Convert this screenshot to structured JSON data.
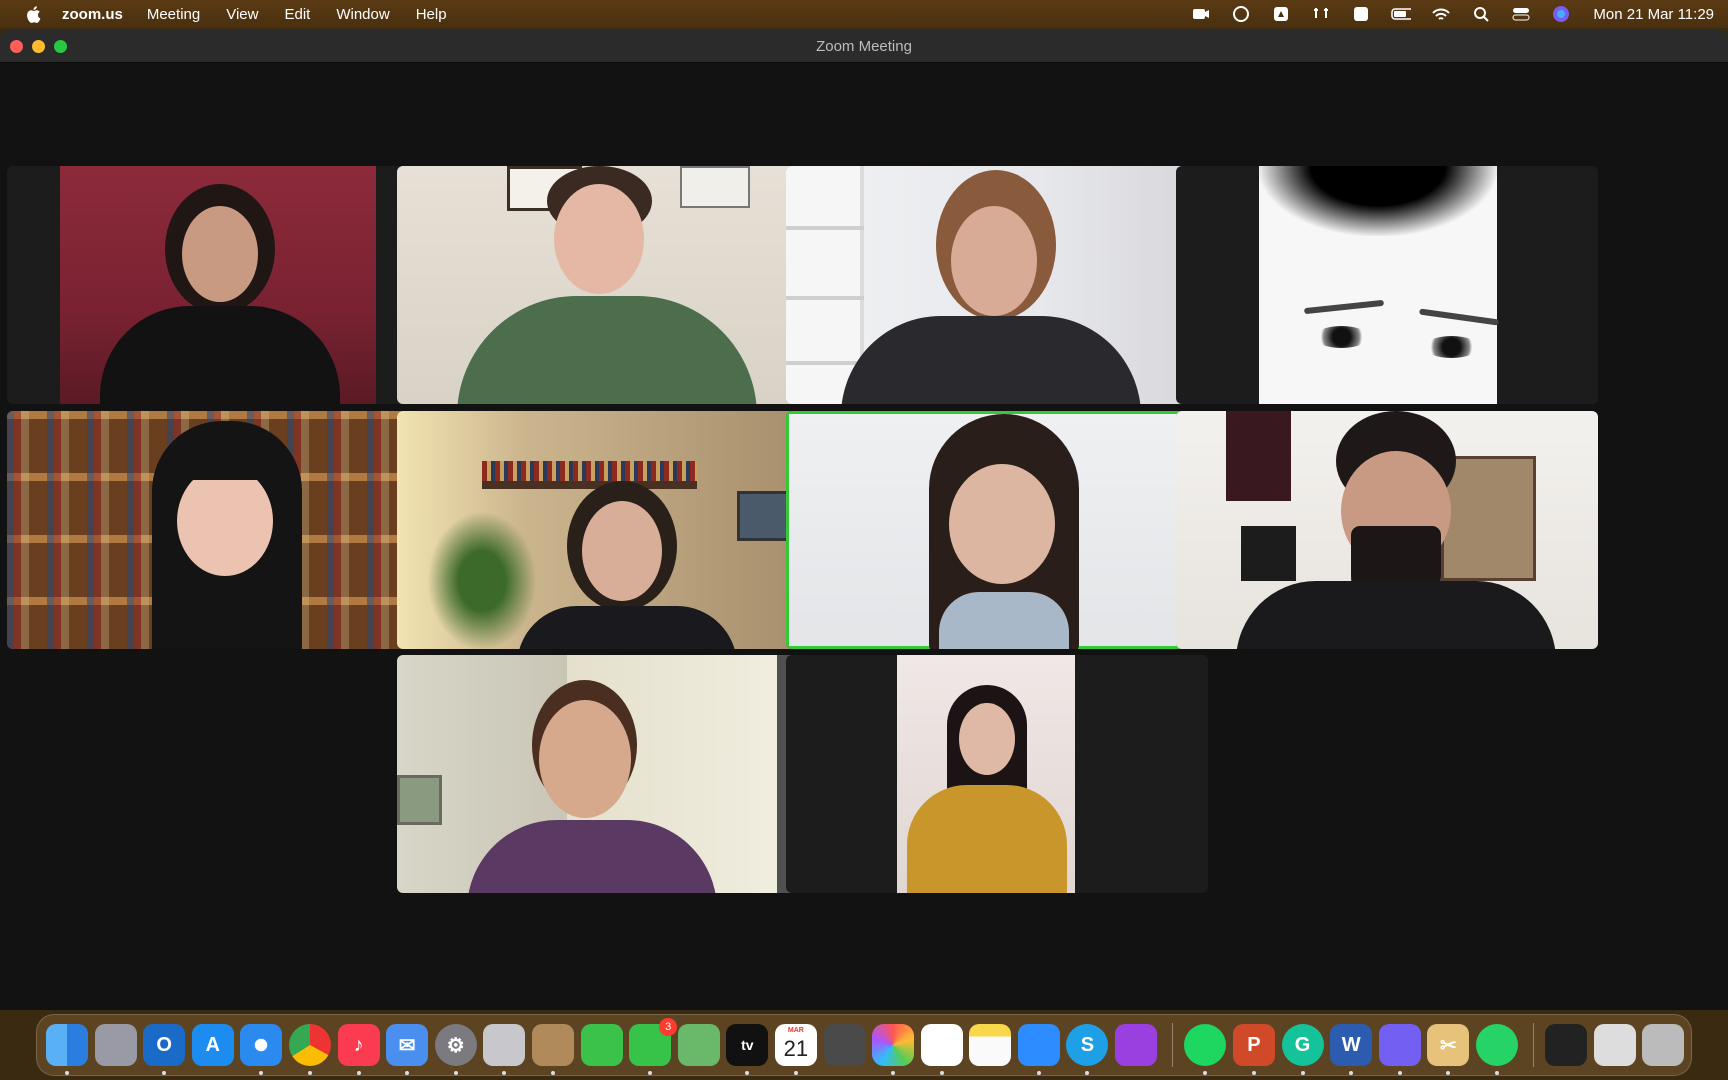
{
  "menubar": {
    "app_name": "zoom.us",
    "items": [
      "Meeting",
      "View",
      "Edit",
      "Window",
      "Help"
    ],
    "clock": "Mon 21 Mar  11:29"
  },
  "window": {
    "title": "Zoom Meeting"
  },
  "dock": {
    "calendar_month": "MAR",
    "calendar_day": "21",
    "messages_badge": "3",
    "tv_label": "tv"
  }
}
